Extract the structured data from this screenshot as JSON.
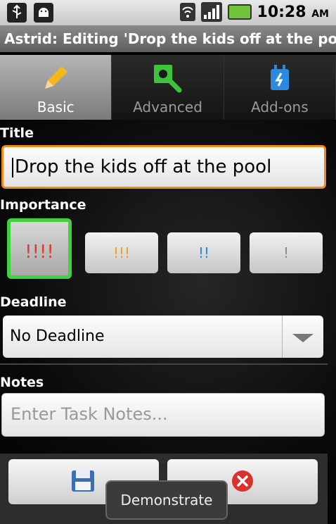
{
  "status_bar": {
    "time": "10:28",
    "ampm": "AM"
  },
  "title_bar": {
    "text": "Astrid: Editing 'Drop the kids off at the pool '"
  },
  "tabs": [
    {
      "label": "Basic",
      "icon": "pencil-icon"
    },
    {
      "label": "Advanced",
      "icon": "wrench-icon"
    },
    {
      "label": "Add-ons",
      "icon": "plug-icon"
    }
  ],
  "form": {
    "title_label": "Title",
    "title_value": "Drop the kids off at the pool",
    "importance_label": "Importance",
    "importance_options": [
      "!!!!",
      "!!!",
      "!!",
      "!"
    ],
    "importance_colors": [
      "#e53935",
      "#f0a020",
      "#2a8ae0",
      "#888888"
    ],
    "deadline_label": "Deadline",
    "deadline_value": "No Deadline",
    "notes_label": "Notes",
    "notes_placeholder": "Enter Task Notes..."
  },
  "buttons": {
    "save_icon": "floppy-disk-icon",
    "discard_icon": "red-x-circle-icon"
  },
  "toast": {
    "text": "Demonstrate"
  },
  "colors": {
    "focus_border": "#f08a1a",
    "selected_importance": "#3fd23f"
  }
}
